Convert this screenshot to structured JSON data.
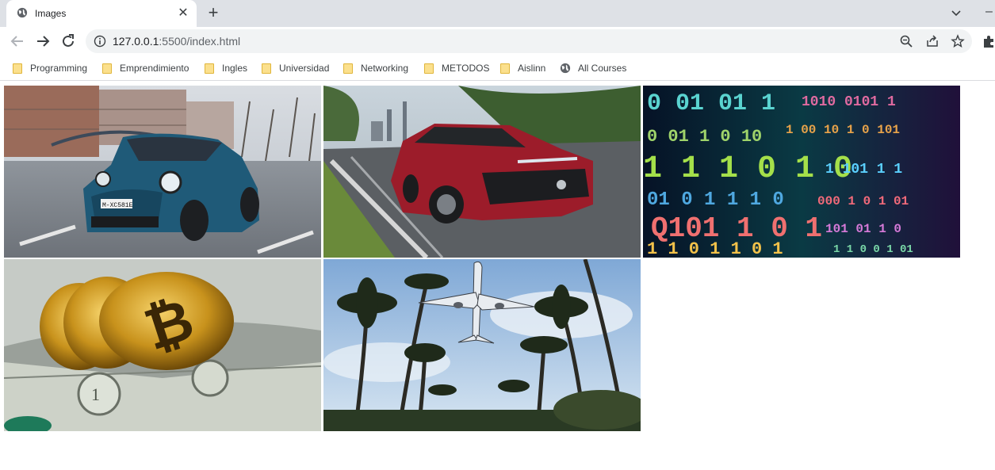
{
  "browser": {
    "tab": {
      "title": "Images",
      "close_glyph": "✕"
    },
    "new_tab_glyph": "+",
    "minimize_glyph": "–",
    "url": {
      "host": "127.0.0.1",
      "rest": ":5500/index.html"
    }
  },
  "bookmarks": [
    {
      "label": "Programming",
      "icon": "folder-icon"
    },
    {
      "label": "Emprendimiento",
      "icon": "folder-icon"
    },
    {
      "label": "Ingles",
      "icon": "folder-icon"
    },
    {
      "label": "Universidad",
      "icon": "folder-icon"
    },
    {
      "label": "Networking",
      "icon": "folder-icon"
    },
    {
      "label": "METODOS",
      "icon": "folder-icon"
    },
    {
      "label": "Aislinn",
      "icon": "folder-icon"
    },
    {
      "label": "All Courses",
      "icon": "globe-icon"
    }
  ],
  "gallery": {
    "images": [
      {
        "subject": "blue-mini-cooper-car",
        "plate_text": "M-XC581E"
      },
      {
        "subject": "red-toyota-suv"
      },
      {
        "subject": "binary-code-screen"
      },
      {
        "subject": "bitcoin-coins-on-dollars"
      },
      {
        "subject": "airplane-over-palm-trees"
      }
    ]
  },
  "colors": {
    "tabstrip_bg": "#dee1e6",
    "omnibox_bg": "#f1f3f4",
    "folder_fill": "#fbe08d"
  }
}
